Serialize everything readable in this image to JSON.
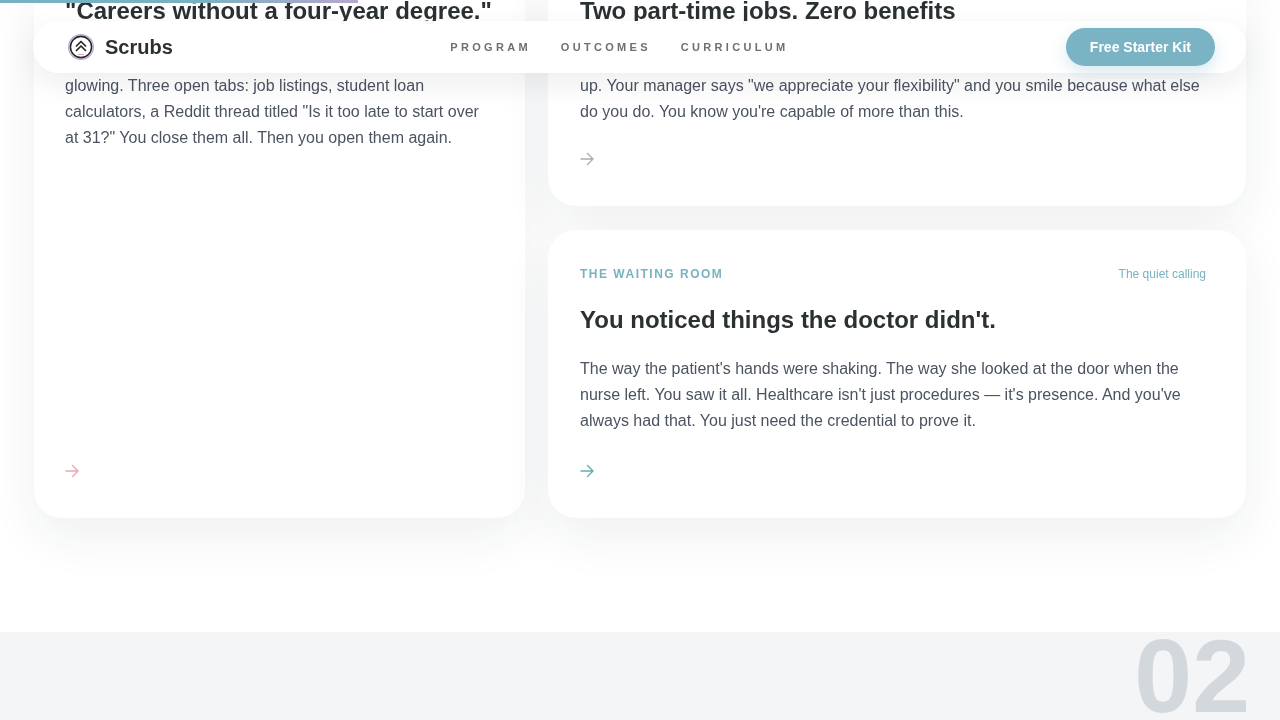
{
  "reading_progress": {
    "level": 0.28
  },
  "header": {
    "brand": "Scrubs",
    "nav": [
      {
        "label": "PROGRAM"
      },
      {
        "label": "OUTCOMES"
      },
      {
        "label": "CURRICULUM"
      }
    ],
    "cta": "Free Starter Kit"
  },
  "cards": [
    {
      "title": "\"Careers without a four-year degree.\"",
      "body": "glowing. Three open tabs: job listings, student loan calculators, a Reddit thread titled \"Is it too late to start over at 31?\" You close them all. Then you open them again.",
      "color": "#e3a9b4"
    },
    {
      "title": "Two part-time jobs. Zero benefits",
      "body": "up. Your manager says \"we appreciate your flexibility\" and you smile because what else do you do. You know you're capable of more than this.",
      "color": "#a9adb1"
    },
    {
      "tag": "THE WAITING ROOM",
      "aside": "The quiet calling",
      "title": "You noticed things the doctor didn't.",
      "body": "The way the patient's hands were shaking. The way she looked at the door when the nurse left. You saw it all. Healthcare isn't just procedures — it's presence. And you've always had that. You just need the credential to prove it.",
      "color": "#64aeb0"
    }
  ],
  "next_section": {
    "number": "02"
  }
}
